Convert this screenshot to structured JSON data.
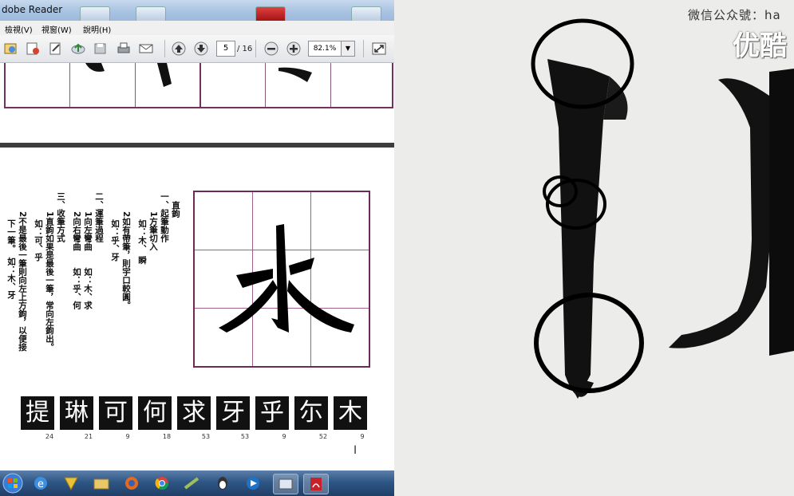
{
  "window": {
    "title": "dobe Reader"
  },
  "menu": {
    "items": [
      "檢視(V)",
      "視窗(W)",
      "說明(H)"
    ]
  },
  "toolbar": {
    "page_current": "5",
    "page_total": "/ 16",
    "zoom": "82.1%"
  },
  "document": {
    "columns": [
      "直鉤",
      "一、起筆動作",
      "1方筆切入",
      "如：木、 瞬",
      "2如有帶筆，則宇口較圓。",
      "如：乎、牙",
      "二、運筆過程",
      "1向左彎曲　　如：木、求",
      "2向右彎曲　　如：乎、何",
      "三、收筆方式",
      "1直鉤如果是最後一筆，常向左鉤出。",
      "如：可、乎",
      "2不是最後一筆則向左上方鉤，以便接",
      "下一筆。　如：木、牙"
    ],
    "main_char": "水",
    "examples": [
      {
        "char": "提",
        "num": "24"
      },
      {
        "char": "琳",
        "num": "21"
      },
      {
        "char": "可",
        "num": "9"
      },
      {
        "char": "何",
        "num": "18"
      },
      {
        "char": "求",
        "num": "53"
      },
      {
        "char": "牙",
        "num": "53"
      },
      {
        "char": "乎",
        "num": "9"
      },
      {
        "char": "尓",
        "num": "52"
      },
      {
        "char": "木",
        "num": "9"
      }
    ]
  },
  "video": {
    "watermark": "微信公众號：ha",
    "logo": "优酷"
  },
  "colors": {
    "grid_border": "#74305f",
    "taskbar": "#2e5685",
    "paper": "#ececea"
  }
}
